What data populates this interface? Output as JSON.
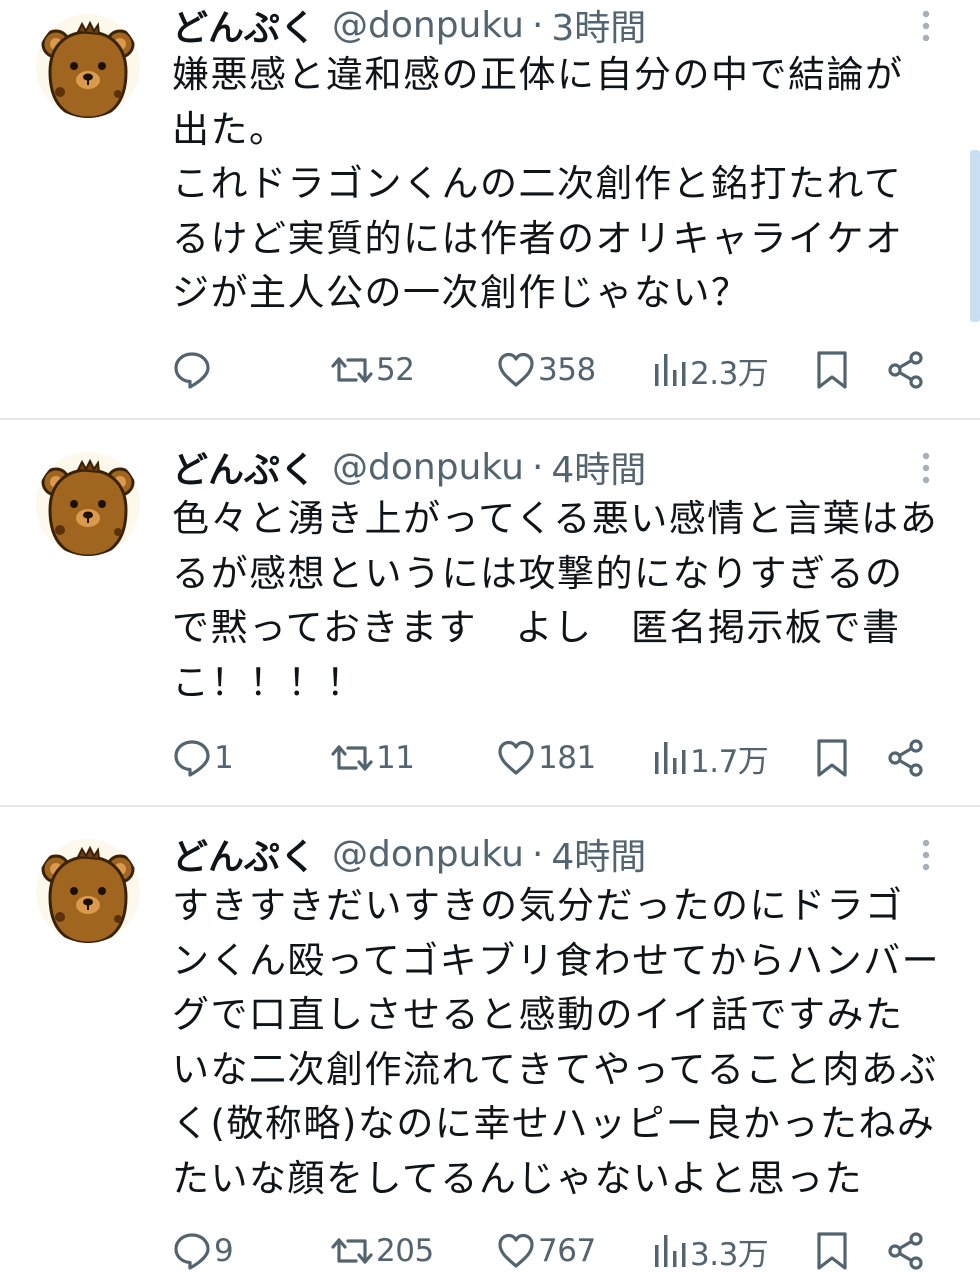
{
  "tweets": [
    {
      "name": "どんぷく",
      "handle": "@donpuku",
      "separator": "·",
      "time": "3時間",
      "text": "嫌悪感と違和感の正体に自分の中で結論が\n出た。\nこれドラゴンくんの二次創作と銘打たれて\nるけど実質的には作者のオリキャライケオ\nジが主人公の一次創作じゃない？",
      "reply_count": "",
      "retweet_count": "52",
      "like_count": "358",
      "view_count": "2.3万"
    },
    {
      "name": "どんぷく",
      "handle": "@donpuku",
      "separator": "·",
      "time": "4時間",
      "text": "色々と湧き上がってくる悪い感情と言葉はあ\nるが感想というには攻撃的になりすぎるの\nで黙っておきます　よし　匿名掲示板で書\nこ！！！！",
      "reply_count": "1",
      "retweet_count": "11",
      "like_count": "181",
      "view_count": "1.7万"
    },
    {
      "name": "どんぷく",
      "handle": "@donpuku",
      "separator": "·",
      "time": "4時間",
      "text": "すきすきだいすきの気分だったのにドラゴ\nンくん殴ってゴキブリ食わせてからハンバー\nグで口直しさせると感動のイイ話ですみた\nいな二次創作流れてきてやってること肉あぶ\nく(敬称略)なのに幸せハッピー良かったねみ\nたいな顔をしてるんじゃないよと思った",
      "reply_count": "9",
      "retweet_count": "205",
      "like_count": "767",
      "view_count": "3.3万"
    }
  ],
  "icons": {
    "reply": "reply-icon",
    "retweet": "retweet-icon",
    "like": "heart-icon",
    "views": "views-icon",
    "bookmark": "bookmark-icon",
    "share": "share-icon",
    "more": "more-vertical-icon",
    "avatar": "bear-avatar"
  },
  "colors": {
    "text": "#0f1419",
    "secondary": "#536471",
    "divider": "#e6e9eb",
    "avatar_brown": "#a0651f",
    "scrollbar": "#c9dff3"
  }
}
